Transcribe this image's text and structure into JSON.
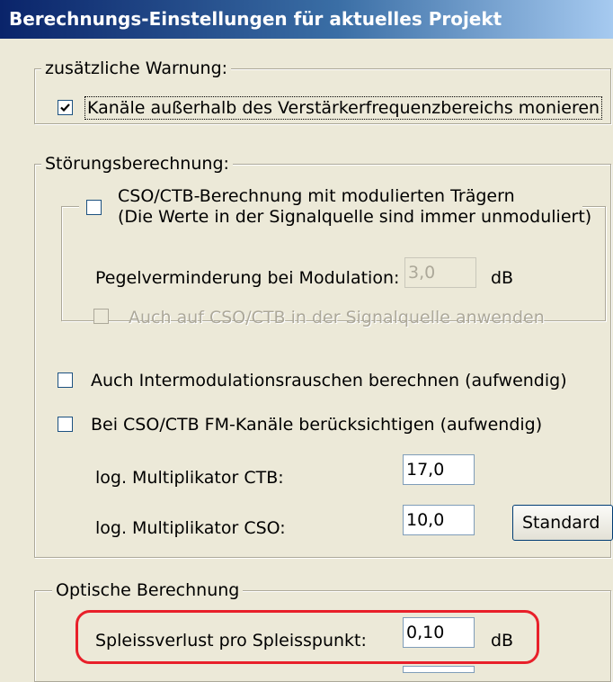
{
  "window": {
    "title": "Berechnungs-Einstellungen für aktuelles Projekt"
  },
  "warning_group": {
    "legend": "zusätzliche Warnung:",
    "check_out_of_range": {
      "label": "Kanäle außerhalb des Verstärkerfrequenzbereichs monieren",
      "checked": true
    }
  },
  "interference_group": {
    "legend": "Störungsberechnung:",
    "modulated_carriers": {
      "label_line1": "CSO/CTB-Berechnung mit modulierten Trägern",
      "label_line2": "(Die Werte in der Signalquelle sind immer unmoduliert)",
      "checked": false
    },
    "level_reduction": {
      "label": "Pegelverminderung bei Modulation:",
      "value": "3,0",
      "unit": "dB",
      "enabled": false
    },
    "apply_to_source": {
      "label": "Auch auf CSO/CTB in der Signalquelle anwenden",
      "checked": false,
      "enabled": false
    },
    "intermod_noise": {
      "label": "Auch Intermodulationsrauschen berechnen (aufwendig)",
      "checked": false
    },
    "fm_channels": {
      "label": "Bei CSO/CTB FM-Kanäle berücksichtigen (aufwendig)",
      "checked": false
    },
    "ctb_multiplier": {
      "label": "log. Multiplikator CTB:",
      "value": "17,0"
    },
    "cso_multiplier": {
      "label": "log. Multiplikator CSO:",
      "value": "10,0"
    },
    "standard_button": "Standard"
  },
  "optical_group": {
    "legend": "Optische Berechnung",
    "splice_loss": {
      "label": "Spleissverlust pro Spleisspunkt:",
      "value": "0,10",
      "unit": "dB"
    }
  },
  "colors": {
    "dialog_bg": "#ece9d8",
    "title_start": "#0a246a",
    "title_end": "#a6caf0",
    "highlight_red": "#e8202a",
    "disabled_text": "#aca899"
  }
}
